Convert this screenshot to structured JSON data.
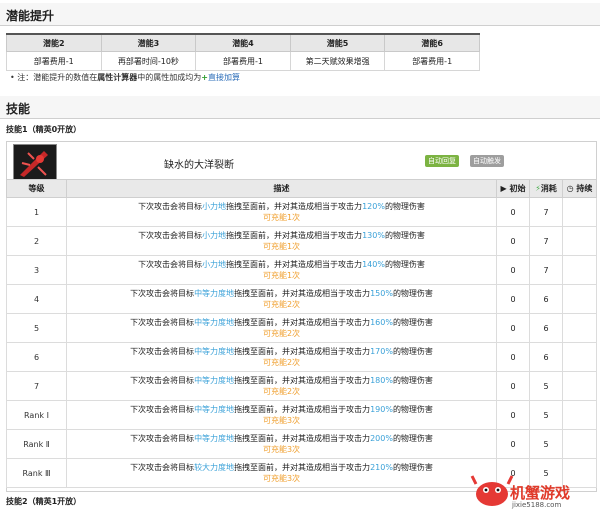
{
  "potential": {
    "title": "潜能提升",
    "headers": [
      "潜能2",
      "潜能3",
      "潜能4",
      "潜能5",
      "潜能6"
    ],
    "values": [
      "部署费用-1",
      "再部署时间-10秒",
      "部署费用-1",
      "第二天赋效果增强",
      "部署费用-1"
    ],
    "note_prefix": "注：潜能提升的数值在",
    "note_bold": "属性计算器",
    "note_mid": "中的属性加成均为",
    "note_link": "直接加算"
  },
  "skills": {
    "title": "技能",
    "skill1_label": "技能1（精英0开放）",
    "skill2_label": "技能2（精英1开放）",
    "name": "缺水的大洋裂断",
    "tag_recover": "自动回复",
    "tag_trigger": "自动触发",
    "headers": {
      "level": "等级",
      "desc": "描述",
      "init": "初始",
      "cost": "消耗",
      "duration": "持续"
    },
    "rows": [
      {
        "level": "1",
        "pre": "下次攻击会将目标",
        "force": "小力地",
        "mid": "拖拽至面前，并对其造成相当于攻击力",
        "pct": "120%",
        "post": "的物理伤害",
        "charge": "可充能1次",
        "init": "0",
        "cost": "7"
      },
      {
        "level": "2",
        "pre": "下次攻击会将目标",
        "force": "小力地",
        "mid": "拖拽至面前，并对其造成相当于攻击力",
        "pct": "130%",
        "post": "的物理伤害",
        "charge": "可充能1次",
        "init": "0",
        "cost": "7"
      },
      {
        "level": "3",
        "pre": "下次攻击会将目标",
        "force": "小力地",
        "mid": "拖拽至面前，并对其造成相当于攻击力",
        "pct": "140%",
        "post": "的物理伤害",
        "charge": "可充能1次",
        "init": "0",
        "cost": "7"
      },
      {
        "level": "4",
        "pre": "下次攻击会将目标",
        "force": "中等力度地",
        "mid": "拖拽至面前，并对其造成相当于攻击力",
        "pct": "150%",
        "post": "的物理伤害",
        "charge": "可充能2次",
        "init": "0",
        "cost": "6"
      },
      {
        "level": "5",
        "pre": "下次攻击会将目标",
        "force": "中等力度地",
        "mid": "拖拽至面前，并对其造成相当于攻击力",
        "pct": "160%",
        "post": "的物理伤害",
        "charge": "可充能2次",
        "init": "0",
        "cost": "6"
      },
      {
        "level": "6",
        "pre": "下次攻击会将目标",
        "force": "中等力度地",
        "mid": "拖拽至面前，并对其造成相当于攻击力",
        "pct": "170%",
        "post": "的物理伤害",
        "charge": "可充能2次",
        "init": "0",
        "cost": "6"
      },
      {
        "level": "7",
        "pre": "下次攻击会将目标",
        "force": "中等力度地",
        "mid": "拖拽至面前，并对其造成相当于攻击力",
        "pct": "180%",
        "post": "的物理伤害",
        "charge": "可充能2次",
        "init": "0",
        "cost": "5"
      },
      {
        "level": "Rank Ⅰ",
        "pre": "下次攻击会将目标",
        "force": "中等力度地",
        "mid": "拖拽至面前，并对其造成相当于攻击力",
        "pct": "190%",
        "post": "的物理伤害",
        "charge": "可充能3次",
        "init": "0",
        "cost": "5"
      },
      {
        "level": "Rank Ⅱ",
        "pre": "下次攻击会将目标",
        "force": "中等力度地",
        "mid": "拖拽至面前，并对其造成相当于攻击力",
        "pct": "200%",
        "post": "的物理伤害",
        "charge": "可充能3次",
        "init": "0",
        "cost": "5"
      },
      {
        "level": "Rank Ⅲ",
        "pre": "下次攻击会将目标",
        "force": "较大力度地",
        "mid": "拖拽至面前，并对其造成相当于攻击力",
        "pct": "210%",
        "post": "的物理伤害",
        "charge": "可充能3次",
        "init": "0",
        "cost": "5"
      }
    ]
  },
  "watermark": {
    "name": "机蟹游戏",
    "url": "jixie5188.com"
  },
  "colors": {
    "highlight": "#3aa1d8",
    "charge": "#f0a030",
    "tag_green": "#7cb342",
    "tag_gray": "#9e9e9e",
    "brand": "#e03a2a"
  }
}
